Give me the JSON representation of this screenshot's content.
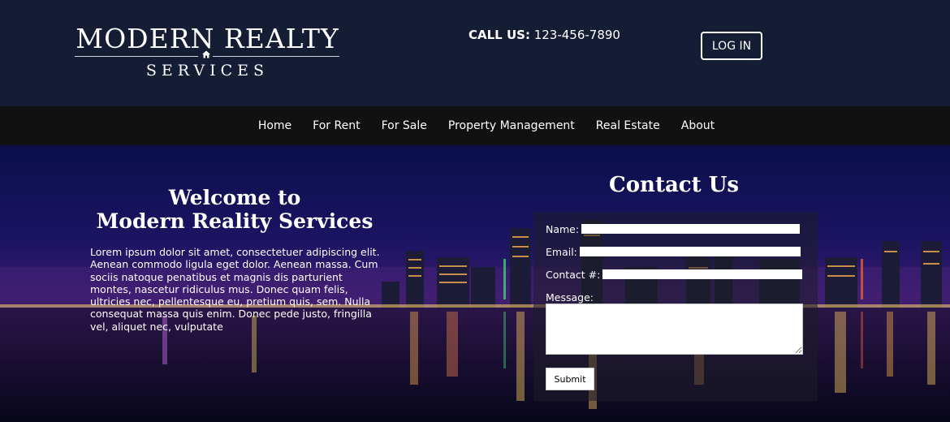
{
  "brand": {
    "name_main": "MODERN REALTY",
    "name_sub": "SERVICES"
  },
  "header": {
    "call_label": "CALL US:",
    "phone": "123-456-7890",
    "login_label": "LOG IN"
  },
  "nav": {
    "items": [
      "Home",
      "For Rent",
      "For Sale",
      "Property Management",
      "Real Estate",
      "About"
    ]
  },
  "hero": {
    "welcome_line1": "Welcome to",
    "welcome_line2": "Modern Reality Services",
    "body": "Lorem ipsum dolor sit amet, consectetuer adipiscing elit. Aenean commodo ligula eget dolor. Aenean massa. Cum sociis natoque penatibus et magnis dis parturient montes, nascetur ridiculus mus. Donec quam felis, ultricies nec, pellentesque eu, pretium quis, sem. Nulla consequat massa quis enim. Donec pede justo, fringilla vel, aliquet nec, vulputate"
  },
  "contact": {
    "title": "Contact Us",
    "name_label": "Name:",
    "email_label": "Email:",
    "phone_label": "Contact #:",
    "message_label": "Message:",
    "submit_label": "Submit"
  },
  "colors": {
    "header_bg": "#151d35",
    "nav_bg": "#111111"
  },
  "icons": {
    "logo_mark": "house-icon"
  }
}
